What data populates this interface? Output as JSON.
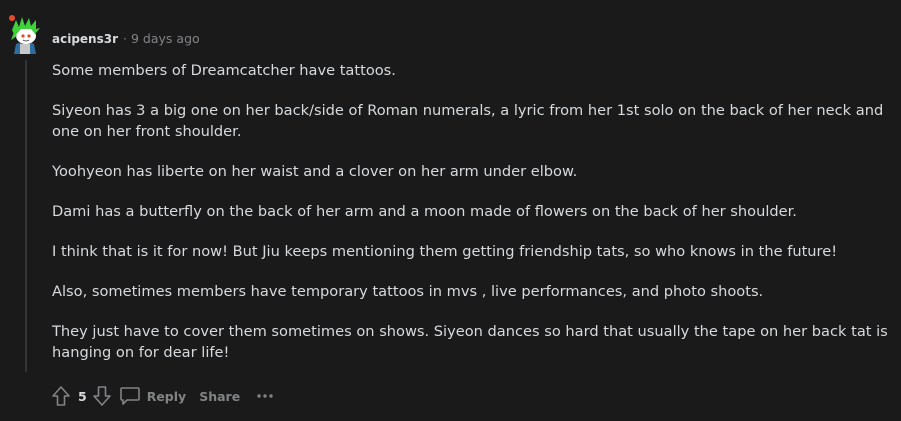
{
  "comment": {
    "author": "acipens3r",
    "separator": "·",
    "timestamp": "9 days ago",
    "paragraphs": [
      "Some members of Dreamcatcher have tattoos.",
      "Siyeon has 3 a big one on her back/side of Roman numerals, a lyric from her 1st solo on the back of her neck and one on her front shoulder.",
      "Yoohyeon has liberte on her waist and a clover on her arm under elbow.",
      "Dami has a butterfly on the back of her arm and a moon made of flowers on the back of her shoulder.",
      "I think that is it for now! But Jiu keeps mentioning them getting friendship tats, so who knows in the future!",
      "Also, sometimes members have temporary tattoos in mvs , live performances, and photo shoots.",
      "They just have to cover them sometimes on shows. Siyeon dances so hard that usually the tape on her back tat is hanging on for dear life!"
    ],
    "score": "5",
    "reply_label": "Reply",
    "share_label": "Share",
    "more_label": "···"
  },
  "icons": {
    "avatar": "snoo-avatar-green-hair",
    "upvote": "upvote-arrow-icon",
    "downvote": "downvote-arrow-icon",
    "reply": "speech-bubble-icon",
    "more": "ellipsis-icon"
  },
  "colors": {
    "background": "#1a1a1b",
    "text": "#d7dadc",
    "meta": "#818384",
    "thread_line": "#343536",
    "avatar_hair": "#3fd13a"
  }
}
